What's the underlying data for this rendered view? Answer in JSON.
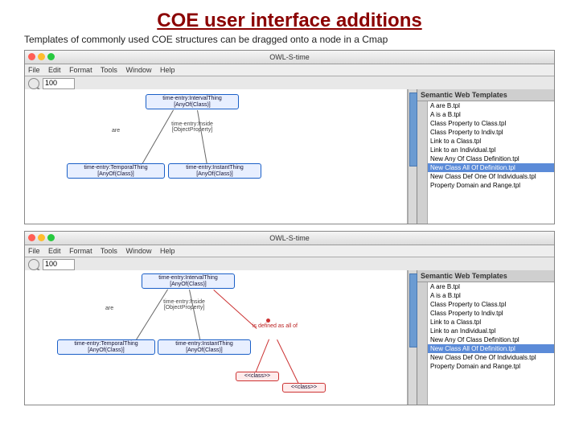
{
  "title": "COE user interface additions",
  "subtitle": "Templates of commonly used COE structures can be dragged onto a node in a Cmap",
  "window_title": "OWL-S-time",
  "menu": {
    "file": "File",
    "edit": "Edit",
    "format": "Format",
    "tools": "Tools",
    "window": "Window",
    "help": "Help"
  },
  "zoom": "100",
  "panel_title": "Semantic Web Templates",
  "templates": [
    "A are B.tpl",
    "A is a B.tpl",
    "Class Property to Class.tpl",
    "Class Property to Indiv.tpl",
    "Link to a Class.tpl",
    "Link to an Individual.tpl",
    "New Any Of Class Definition.tpl",
    "New Class All Of Definition.tpl",
    "New Class Def One Of Individuals.tpl",
    "Property Domain and Range.tpl"
  ],
  "nodes": {
    "root": "time-entry:IntervalThing\n[AnyOf(Class)]",
    "relprop": "time-entry:Inside\n[ObjectProperty]",
    "left": "time-entry:TemporalThing\n[AnyOf(Class)]",
    "mid": "time-entry:InstantThing\n[AnyOf(Class)]",
    "defined": "is defined as\nall of",
    "class1": "<<class>>",
    "class2": "<<class>>"
  },
  "rel_are": "are"
}
